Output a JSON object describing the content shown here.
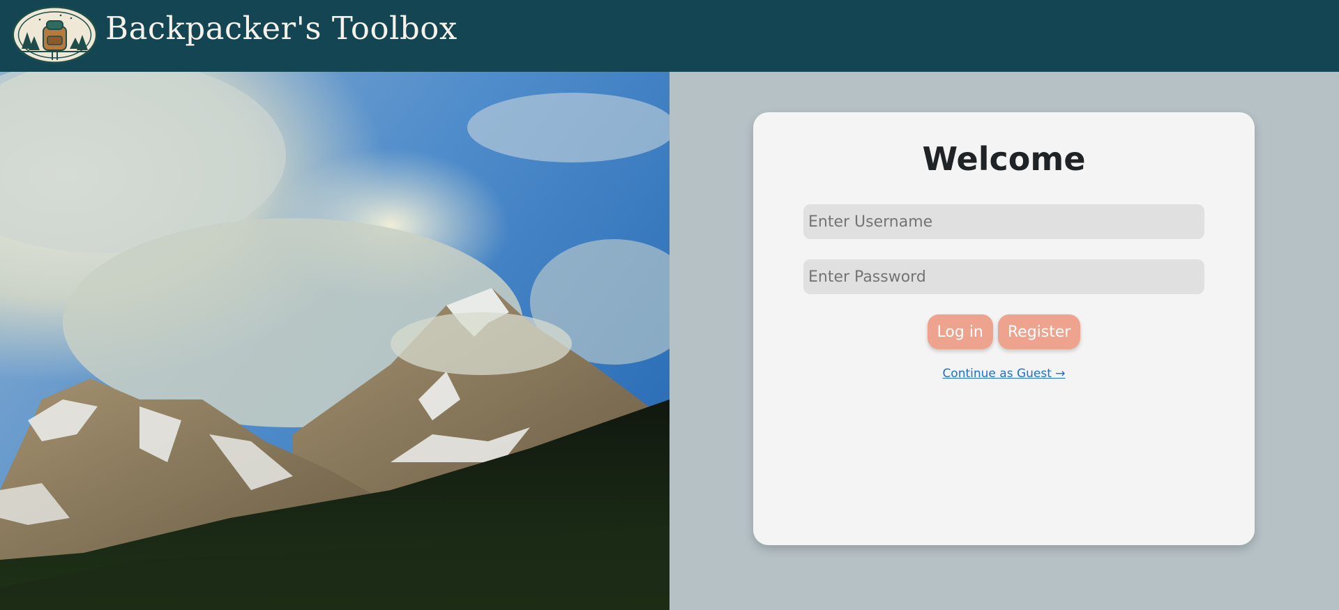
{
  "header": {
    "app_title": "Backpacker's Toolbox",
    "logo_icon": "backpack-forest-logo-icon"
  },
  "hero": {
    "image": "snowy-mountain-peaks-photo"
  },
  "login": {
    "heading": "Welcome",
    "username_placeholder": "Enter Username",
    "username_value": "",
    "password_placeholder": "Enter Password",
    "password_value": "",
    "login_label": "Log in",
    "register_label": "Register",
    "guest_link": "Continue as Guest →"
  },
  "colors": {
    "header_bg": "#134553",
    "panel_bg": "#b6c1c6",
    "card_bg": "#f4f4f4",
    "button_bg": "#eda38e",
    "link": "#1a6fd8"
  }
}
